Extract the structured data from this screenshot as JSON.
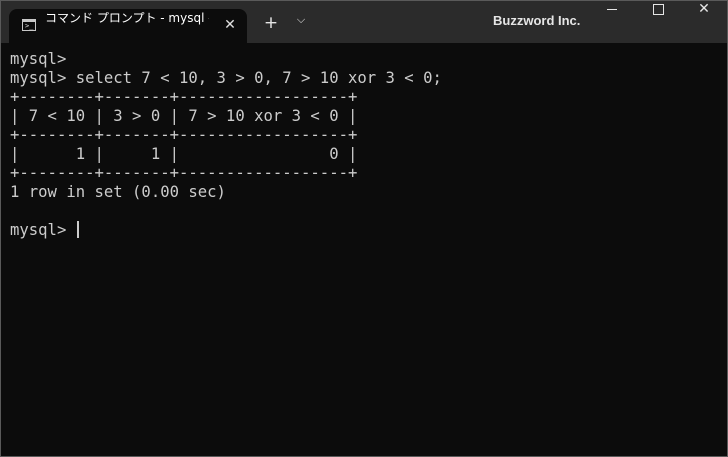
{
  "window": {
    "tab_title": "コマンド プロンプト - mysql  -u roo",
    "brand": "Buzzword Inc.",
    "new_tab_symbol": "+",
    "dropdown_symbol": "⌵",
    "close_tab_symbol": "✕",
    "close_window_symbol": "✕",
    "tab_icon": "terminal-icon",
    "tab_icon_glyph": ">_"
  },
  "terminal": {
    "lines": [
      "mysql>",
      "mysql> select 7 < 10, 3 > 0, 7 > 10 xor 3 < 0;",
      "+--------+-------+------------------+",
      "| 7 < 10 | 3 > 0 | 7 > 10 xor 3 < 0 |",
      "+--------+-------+------------------+",
      "|      1 |     1 |                0 |",
      "+--------+-------+------------------+",
      "1 row in set (0.00 sec)",
      ""
    ],
    "current_prompt": "mysql> "
  },
  "colors": {
    "titlebar": "#2b2b2b",
    "tab_active": "#0c0c0c",
    "terminal_bg": "#0c0c0c",
    "terminal_text": "#cccccc"
  }
}
